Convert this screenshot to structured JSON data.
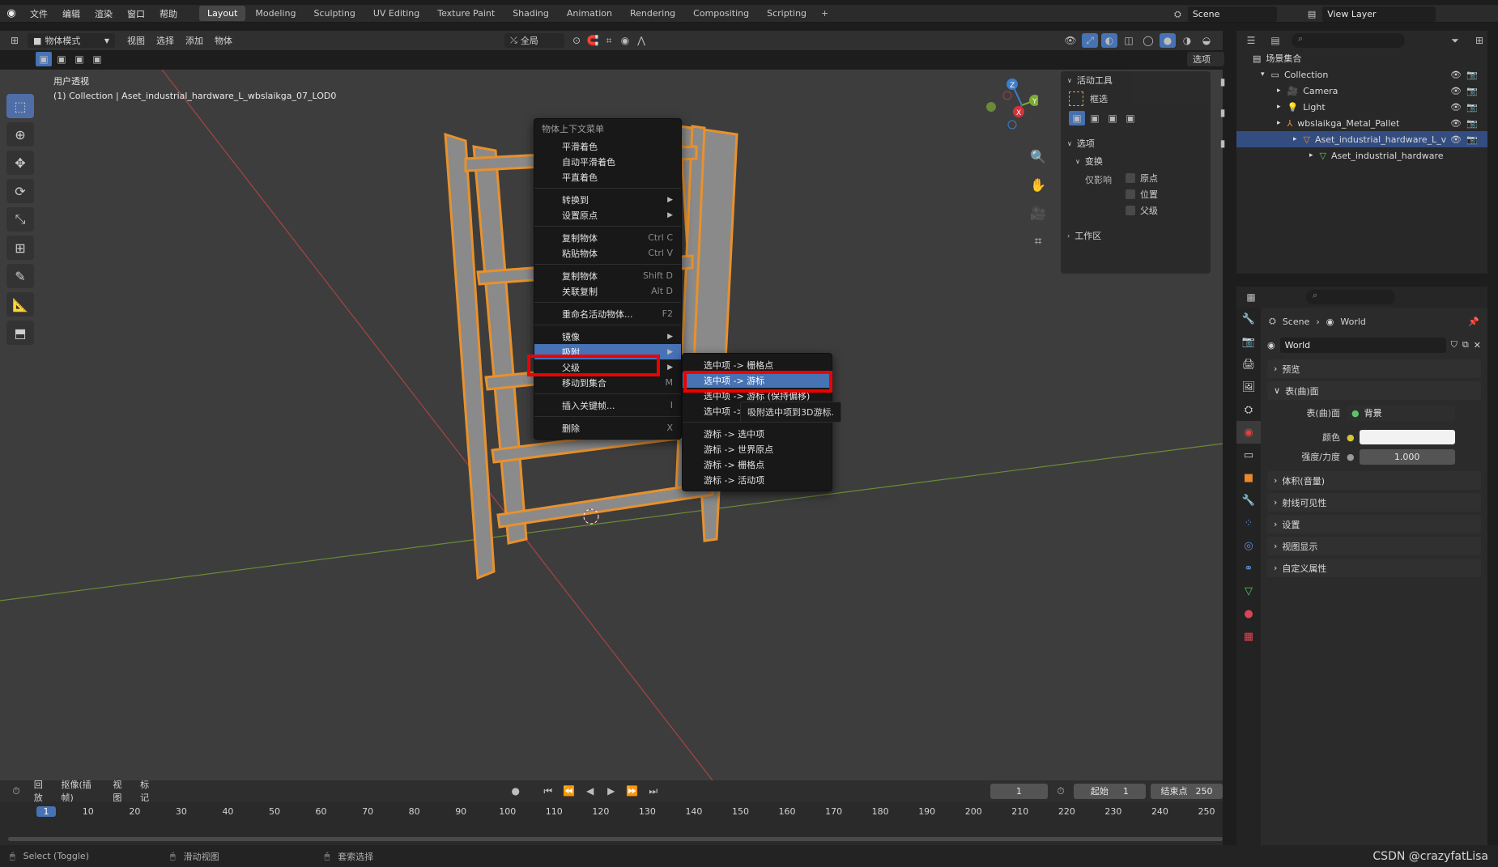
{
  "app": {
    "main_menu": [
      "文件",
      "编辑",
      "渲染",
      "窗口",
      "帮助"
    ],
    "workspaces": [
      "Layout",
      "Modeling",
      "Sculpting",
      "UV Editing",
      "Texture Paint",
      "Shading",
      "Animation",
      "Rendering",
      "Compositing",
      "Scripting"
    ],
    "active_workspace": "Layout",
    "scene": "Scene",
    "view_layer": "View Layer"
  },
  "viewport_header": {
    "mode": "物体模式",
    "menus": [
      "视图",
      "选择",
      "添加",
      "物体"
    ],
    "transform_orientation": "全局",
    "options_label": "选项"
  },
  "viewport": {
    "view_name": "用户透视",
    "view_subtitle": "(1) Collection | Aset_industrial_hardware_L_wbslaikga_07_LOD0"
  },
  "context_menu": {
    "title": "物体上下文菜单",
    "items": [
      {
        "label": "平滑着色",
        "shortcut": "",
        "submenu": false
      },
      {
        "label": "自动平滑着色",
        "shortcut": "",
        "submenu": false
      },
      {
        "label": "平直着色",
        "shortcut": "",
        "submenu": false
      },
      {
        "sep": true
      },
      {
        "label": "转换到",
        "shortcut": "",
        "submenu": true
      },
      {
        "label": "设置原点",
        "shortcut": "",
        "submenu": true
      },
      {
        "sep": true
      },
      {
        "label": "复制物体",
        "shortcut": "Ctrl C",
        "submenu": false
      },
      {
        "label": "粘贴物体",
        "shortcut": "Ctrl V",
        "submenu": false
      },
      {
        "sep": true
      },
      {
        "label": "复制物体",
        "shortcut": "Shift D",
        "submenu": false
      },
      {
        "label": "关联复制",
        "shortcut": "Alt D",
        "submenu": false
      },
      {
        "sep": true
      },
      {
        "label": "重命名活动物体...",
        "shortcut": "F2",
        "submenu": false
      },
      {
        "sep": true
      },
      {
        "label": "镜像",
        "shortcut": "",
        "submenu": true
      },
      {
        "label": "吸附",
        "shortcut": "",
        "submenu": true,
        "highlight": true
      },
      {
        "label": "父级",
        "shortcut": "",
        "submenu": true
      },
      {
        "label": "移动到集合",
        "shortcut": "M",
        "submenu": false
      },
      {
        "sep": true
      },
      {
        "label": "插入关键帧...",
        "shortcut": "I",
        "submenu": false
      },
      {
        "sep": true
      },
      {
        "label": "删除",
        "shortcut": "X",
        "submenu": false
      }
    ]
  },
  "snap_submenu": {
    "items": [
      {
        "label": "选中项 -> 栅格点"
      },
      {
        "label": "选中项 -> 游标",
        "highlight": true
      },
      {
        "label": "选中项 -> 游标 (保持偏移)"
      },
      {
        "label": "选中项 -> 活动项"
      },
      {
        "sep": true
      },
      {
        "label": "游标 -> 选中项"
      },
      {
        "label": "游标 -> 世界原点"
      },
      {
        "label": "游标 -> 栅格点"
      },
      {
        "label": "游标 -> 活动项"
      }
    ],
    "tooltip": "吸附选中项到3D游标."
  },
  "n_panel": {
    "active_tool": "活动工具",
    "tool_name": "框选",
    "options": "选项",
    "transform": "变换",
    "affect_only": "仅影响",
    "checks": [
      "原点",
      "位置",
      "父级"
    ],
    "workspace": "工作区"
  },
  "outliner": {
    "root": "场景集合",
    "rows": [
      {
        "label": "Collection",
        "indent": 1,
        "icon": "collection-icon"
      },
      {
        "label": "Camera",
        "indent": 2,
        "icon": "camera-icon"
      },
      {
        "label": "Light",
        "indent": 2,
        "icon": "light-icon"
      },
      {
        "label": "wbslaikga_Metal_Pallet",
        "indent": 2,
        "icon": "empty-icon"
      },
      {
        "label": "Aset_industrial_hardware_L_v",
        "indent": 3,
        "icon": "mesh-icon",
        "selected": true
      },
      {
        "label": "Aset_industrial_hardware",
        "indent": 4,
        "icon": "mesh-data-icon"
      }
    ]
  },
  "properties": {
    "breadcrumb_scene": "Scene",
    "breadcrumb_world": "World",
    "world_name": "World",
    "sections": {
      "preview": "预览",
      "surface": "表(曲)面",
      "volume": "体积(音量)",
      "ray_visibility": "射线可见性",
      "settings": "设置",
      "viewport_display": "视图显示",
      "custom_props": "自定义属性"
    },
    "surface_label": "表(曲)面",
    "surface_value": "背景",
    "color_label": "颜色",
    "strength_label": "强度/力度",
    "strength_value": "1.000"
  },
  "timeline": {
    "menus": [
      "回放",
      "抠像(插帧)",
      "视图",
      "标记"
    ],
    "current_frame": "1",
    "start_label": "起始",
    "start_value": "1",
    "end_label": "结束点",
    "end_value": "250",
    "ticks": [
      "1",
      "10",
      "20",
      "30",
      "40",
      "50",
      "60",
      "70",
      "80",
      "90",
      "100",
      "110",
      "120",
      "130",
      "140",
      "150",
      "160",
      "170",
      "180",
      "190",
      "200",
      "210",
      "220",
      "230",
      "240",
      "250"
    ]
  },
  "statusbar": {
    "left": "Select (Toggle)",
    "middle": "滑动视图",
    "right": "套索选择",
    "watermark": "CSDN @crazyfatLisa"
  }
}
